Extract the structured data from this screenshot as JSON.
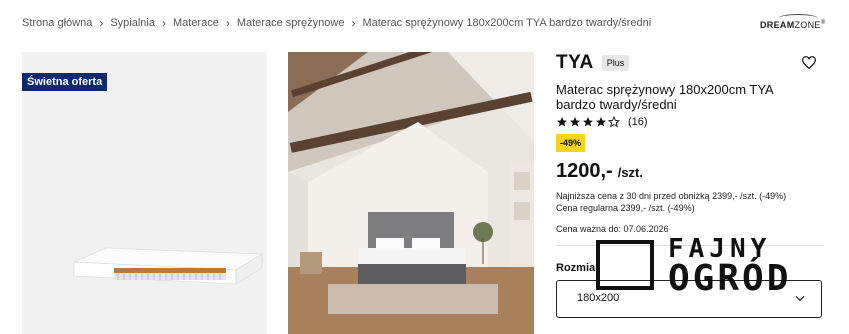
{
  "breadcrumb": [
    "Strona główna",
    "Sypialnia",
    "Materace",
    "Materace sprężynowe",
    "Materac sprężynowy 180x200cm TYA bardzo twardy/średni"
  ],
  "logo": {
    "text_bold": "DREAM",
    "text_rest": "ZONE",
    "mark": "®"
  },
  "gallery": {
    "badge": "Świetna oferta"
  },
  "product": {
    "brand": "TYA",
    "brand_badge": "Plus",
    "title": "Materac sprężynowy 180x200cm TYA bardzo twardy/średni",
    "rating": 4,
    "rating_max": 5,
    "reviews": "(16)",
    "discount": "-49%",
    "price": "1200,-",
    "unit": "/szt.",
    "lowest_price": "Najniższa cena z 30 dni przed obniżką 2399,- /szt. (-49%)",
    "regular_price": "Cena regularna 2399,- /szt. (-49%)",
    "valid_until": "Cena ważna do: 07.06.2026"
  },
  "size": {
    "label": "Rozmiar",
    "value": "180x200"
  },
  "watermark": {
    "line1": "FAJNY",
    "line2": "OGRÓD"
  },
  "colors": {
    "badge_blue": "#0b2a6b",
    "discount_yellow": "#f7d51d"
  },
  "icons": {
    "heart": "heart-icon",
    "star": "star-icon",
    "chevron": "chevron-down-icon"
  }
}
